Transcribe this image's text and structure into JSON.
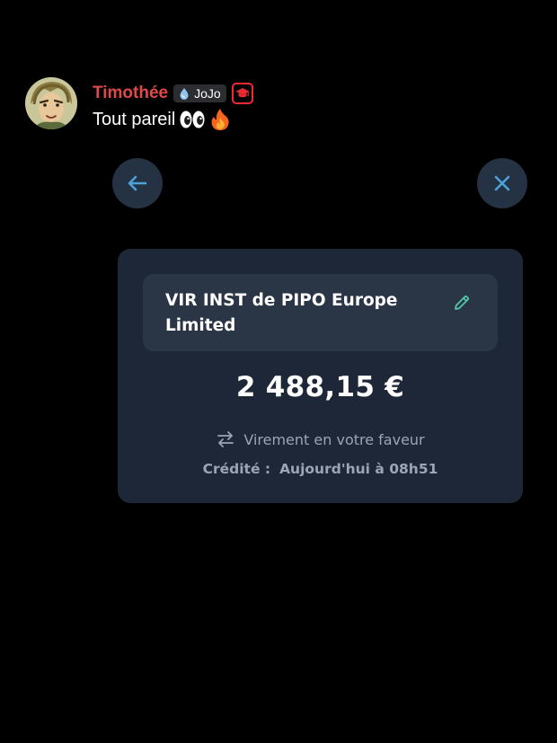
{
  "message": {
    "username": "Timothée",
    "username_color": "#e0494a",
    "tag": {
      "icon": "water-drop-icon",
      "label": "JoJo"
    },
    "role_badge_icon": "graduation-cap-icon",
    "text": "Tout pareil",
    "emojis": [
      "eyes-emoji",
      "fire-emoji"
    ]
  },
  "nav": {
    "back_icon": "arrow-left-icon",
    "close_icon": "close-icon",
    "icon_color": "#4aa3d9"
  },
  "transaction": {
    "label": "VIR INST de PIPO Europe Limited",
    "edit_icon": "pencil-icon",
    "accent_color": "#4fc6a6",
    "amount": "2 488,15 €",
    "type_icon": "transfer-arrows-icon",
    "type_label": "Virement en votre faveur",
    "credit_label": "Crédité :",
    "credit_value": "Aujourd'hui à 08h51"
  }
}
